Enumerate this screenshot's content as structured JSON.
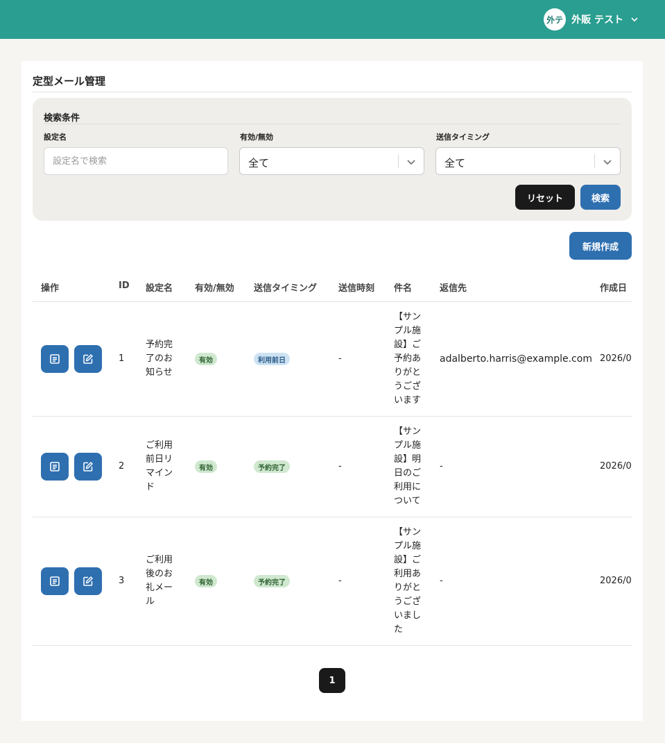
{
  "header": {
    "avatar_text": "外テ",
    "user_name": "外販 テスト",
    "color": "#2a9e90"
  },
  "page": {
    "title": "定型メール管理"
  },
  "search": {
    "title": "検索条件",
    "name_label": "設定名",
    "name_placeholder": "設定名で検索",
    "status_label": "有効/無効",
    "status_value": "全て",
    "timing_label": "送信タイミング",
    "timing_value": "全て",
    "reset_label": "リセット",
    "search_label": "検索"
  },
  "actions": {
    "new_label": "新規作成"
  },
  "table": {
    "headers": [
      "操作",
      "ID",
      "設定名",
      "有効/無効",
      "送信タイミング",
      "送信時刻",
      "件名",
      "返信先",
      "作成日"
    ],
    "rows": [
      {
        "id": "1",
        "name": "予約完\n了のお\n知らせ",
        "status": "有効",
        "timing": "利用前日",
        "time": "-",
        "subject": "【サン\nプル施\n設】ご\n予約あ\nりがと\nうござ\nいます",
        "reply_to": "adalberto.harris@example.com",
        "created": "2026/0"
      },
      {
        "id": "2",
        "name": "ご利用\n前日リ\nマイン\nド",
        "status": "有効",
        "timing": "予約完了",
        "time": "-",
        "subject": "【サン\nプル施\n設】明\n日のご\n利用に\nついて",
        "reply_to": "-",
        "created": "2026/0"
      },
      {
        "id": "3",
        "name": "ご利用\n後のお\n礼メー\nル",
        "status": "有効",
        "timing": "予約完了",
        "time": "-",
        "subject": "【サン\nプル施\n設】ご\n利用あ\nりがと\nうござ\nいまし\nた",
        "reply_to": "-",
        "created": "2026/0"
      }
    ]
  },
  "pagination": {
    "current": "1"
  },
  "colors": {
    "primary": "#2e6fb0",
    "dark": "#1a1a1a",
    "badge_green": "#cfe8cf",
    "badge_blue": "#cde3f4"
  }
}
